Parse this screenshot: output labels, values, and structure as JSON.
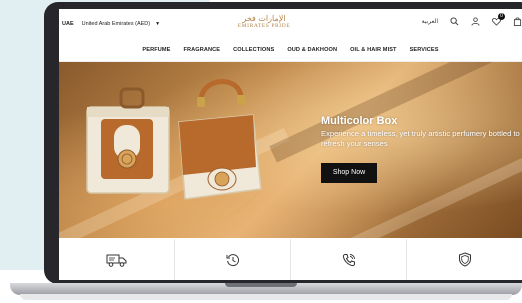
{
  "topbar": {
    "currency_code": "UAE",
    "region": "United Arab Emirates (AED)",
    "logo_arabic": "الإمارات فخر",
    "logo_english": "EMIRATES PRIDE",
    "language": "العربية",
    "wishlist_count": "0"
  },
  "nav": {
    "items": [
      "PERFUME",
      "FRAGRANCE",
      "COLLECTIONS",
      "OUD & DAKHOON",
      "OIL & HAIR MIST",
      "SERVICES"
    ]
  },
  "hero": {
    "title": "Multicolor Box",
    "subtitle": "Experience a timeless, yet truly artistic perfumery bottled to refresh your senses",
    "button": "Shop Now"
  },
  "features": {
    "icons": [
      "delivery-truck-icon",
      "history-clock-icon",
      "phone-support-icon",
      "shield-icon"
    ]
  },
  "colors": {
    "brand_gold": "#b3864b",
    "laptop_frame": "#27272b",
    "background_panel": "#e1eff3"
  }
}
